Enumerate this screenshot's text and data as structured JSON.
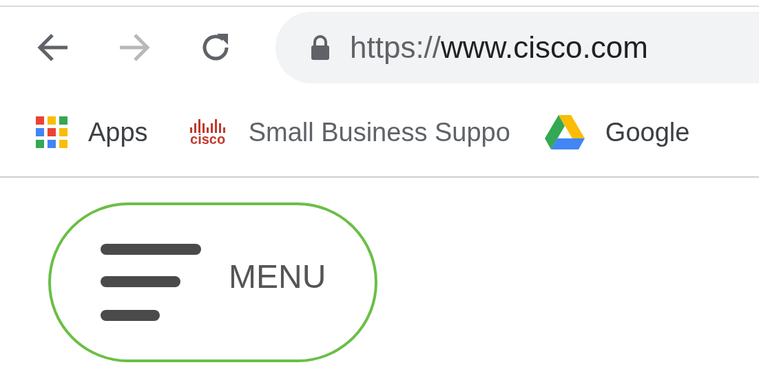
{
  "toolbar": {
    "back": {
      "disabled": false
    },
    "forward": {
      "disabled": true
    },
    "address": {
      "scheme": "https://",
      "host": "www.cisco.com"
    }
  },
  "bookmarks": [
    {
      "kind": "apps",
      "label": "Apps"
    },
    {
      "kind": "cisco",
      "logo_text": "cisco",
      "label": "Small Business Suppo"
    },
    {
      "kind": "drive",
      "label": "Google"
    }
  ],
  "menu_button": {
    "label": "MENU"
  }
}
